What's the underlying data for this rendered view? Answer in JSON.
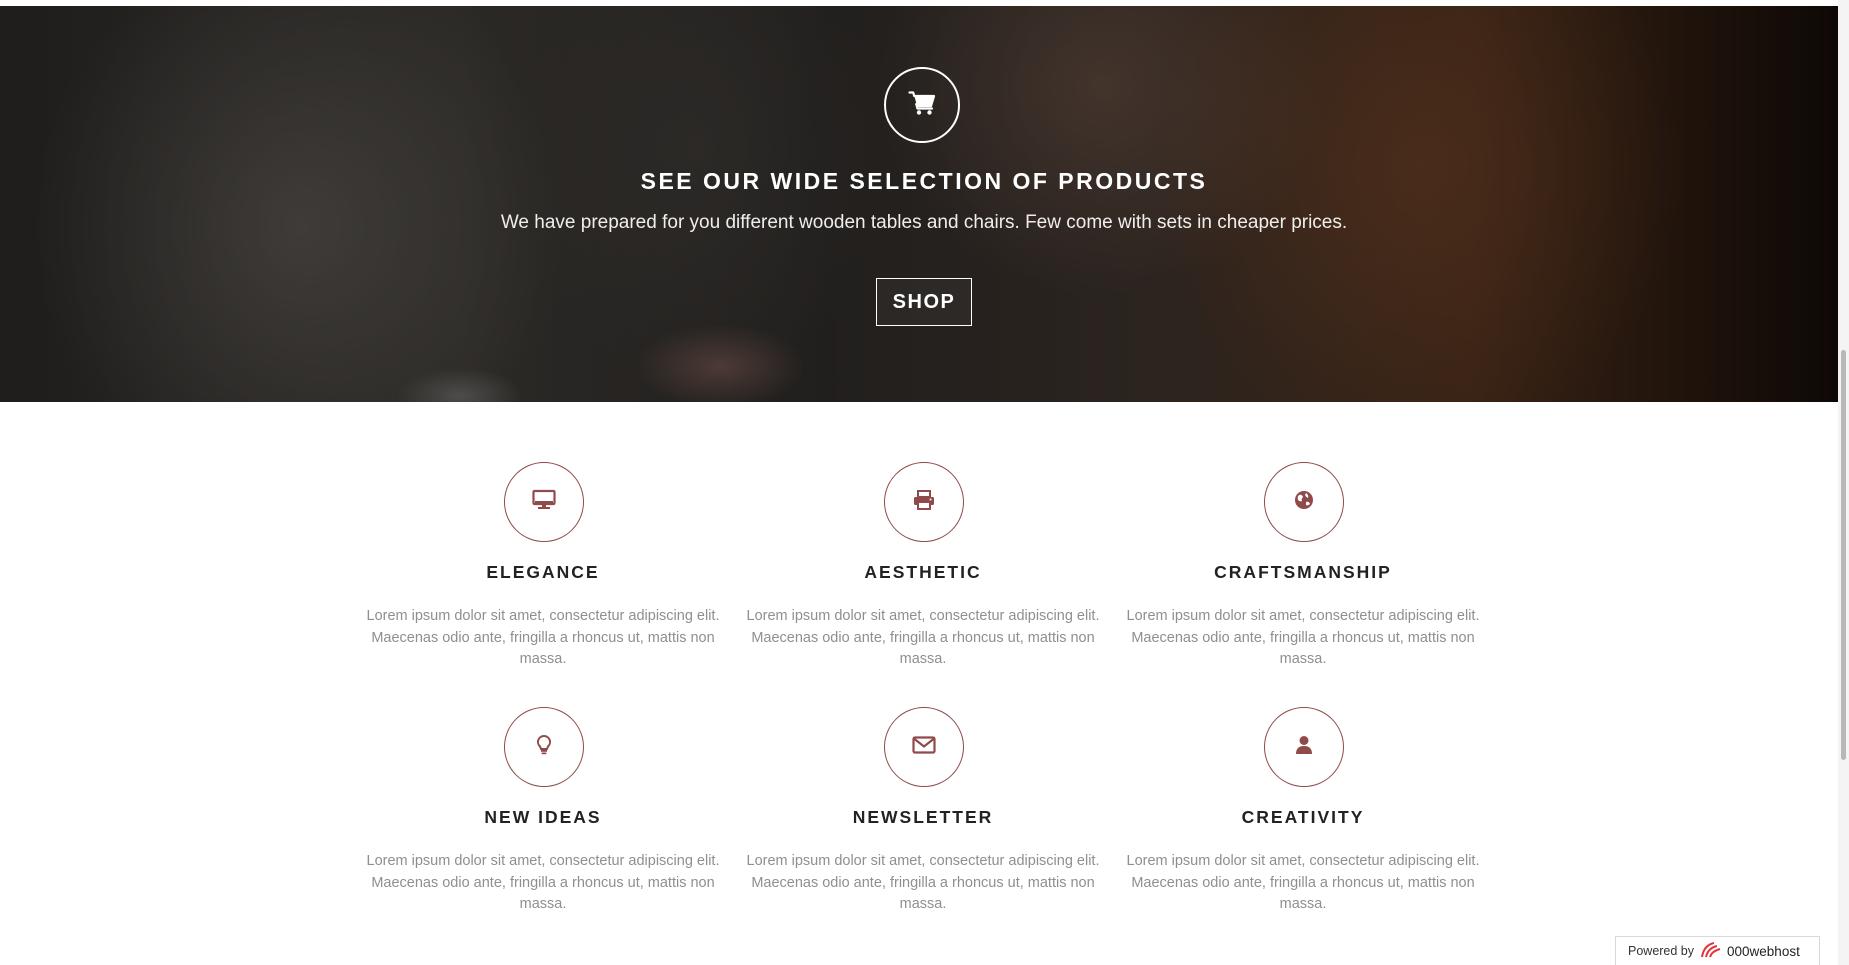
{
  "hero": {
    "icon": "shopping-cart-icon",
    "title": "SEE OUR WIDE SELECTION OF PRODUCTS",
    "subtitle": "We have prepared for you different wooden tables and chairs. Few come with sets in cheaper prices.",
    "button_label": "SHOP"
  },
  "features": [
    {
      "icon": "desktop-icon",
      "title": "ELEGANCE",
      "description": "Lorem ipsum dolor sit amet, consectetur adipiscing elit. Maecenas odio ante, fringilla a rhoncus ut, mattis non massa."
    },
    {
      "icon": "printer-icon",
      "title": "AESTHETIC",
      "description": "Lorem ipsum dolor sit amet, consectetur adipiscing elit. Maecenas odio ante, fringilla a rhoncus ut, mattis non massa."
    },
    {
      "icon": "globe-icon",
      "title": "CRAFTSMANSHIP",
      "description": "Lorem ipsum dolor sit amet, consectetur adipiscing elit. Maecenas odio ante, fringilla a rhoncus ut, mattis non massa."
    },
    {
      "icon": "lightbulb-icon",
      "title": "NEW IDEAS",
      "description": "Lorem ipsum dolor sit amet, consectetur adipiscing elit. Maecenas odio ante, fringilla a rhoncus ut, mattis non massa."
    },
    {
      "icon": "envelope-icon",
      "title": "NEWSLETTER",
      "description": "Lorem ipsum dolor sit amet, consectetur adipiscing elit. Maecenas odio ante, fringilla a rhoncus ut, mattis non massa."
    },
    {
      "icon": "user-icon",
      "title": "CREATIVITY",
      "description": "Lorem ipsum dolor sit amet, consectetur adipiscing elit. Maecenas odio ante, fringilla a rhoncus ut, mattis non massa."
    }
  ],
  "badge": {
    "label": "Powered by",
    "brand": "000webhost"
  },
  "colors": {
    "accent": "#8f4a4a",
    "heading": "#222222",
    "body_text": "#8f8f8f"
  }
}
